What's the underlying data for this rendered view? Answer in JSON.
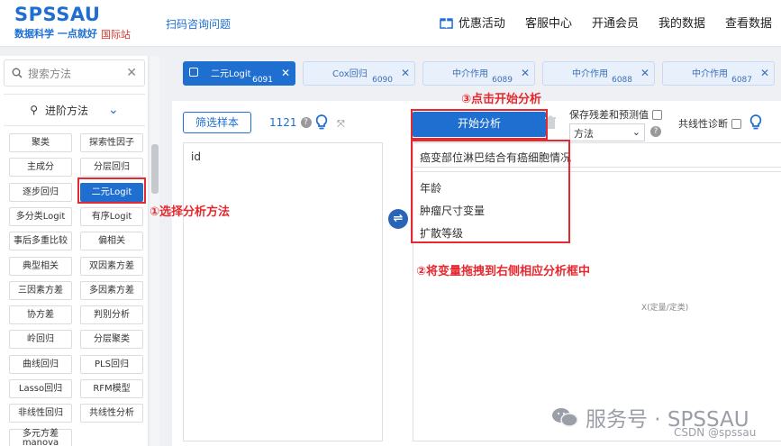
{
  "header": {
    "logo": "SPSSAU",
    "slogan": "数据科学 一点就好",
    "site_tag": "国际站",
    "qr_link": "扫码咨询问题",
    "nav": [
      "优惠活动",
      "客服中心",
      "开通会员",
      "我的数据",
      "查看数据"
    ]
  },
  "sidebar": {
    "search_placeholder": "搜索方法",
    "section": "进阶方法",
    "methods": [
      [
        "聚类",
        "探索性因子"
      ],
      [
        "主成分",
        "分层回归"
      ],
      [
        "逐步回归",
        "二元Logit"
      ],
      [
        "多分类Logit",
        "有序Logit"
      ],
      [
        "事后多重比较",
        "偏相关"
      ],
      [
        "典型相关",
        "双因素方差"
      ],
      [
        "三因素方差",
        "多因素方差"
      ],
      [
        "协方差",
        "判别分析"
      ],
      [
        "岭回归",
        "分层聚类"
      ],
      [
        "曲线回归",
        "PLS回归"
      ],
      [
        "Lasso回归",
        "RFM模型"
      ],
      [
        "非线性回归",
        "共线性分析"
      ],
      [
        "多元方差\nmanova",
        ""
      ]
    ],
    "selected": "二元Logit"
  },
  "tabs": [
    {
      "label": "二元Logit",
      "num": "6091",
      "active": true
    },
    {
      "label": "Cox回归",
      "num": "6090",
      "active": false
    },
    {
      "label": "中介作用",
      "num": "6089",
      "active": false
    },
    {
      "label": "中介作用",
      "num": "6088",
      "active": false
    },
    {
      "label": "中介作用",
      "num": "6087",
      "active": false
    }
  ],
  "panel": {
    "filter_button": "筛选样本",
    "sample_count": "1121",
    "variable_list": [
      "id"
    ],
    "start_button": "开始分析",
    "save_option": "保存残差和预测值",
    "method_select": "方法",
    "collinearity": "共线性诊断",
    "dependent_var": "癌变部位淋巴结合有癌细胞情况",
    "x_vars": [
      "年龄",
      "肿瘤尺寸变量",
      "扩散等级"
    ],
    "x_hint": "X(定量/定类)"
  },
  "annotations": {
    "step1": "①选择分析方法",
    "step2": "②将变量拖拽到右侧相应分析框中",
    "step3": "③点击开始分析"
  },
  "watermark": "服务号 · SPSSAU",
  "csdn": "CSDN @spssau",
  "colors": {
    "primary": "#1f6fd1",
    "annotation": "#e5292f"
  }
}
